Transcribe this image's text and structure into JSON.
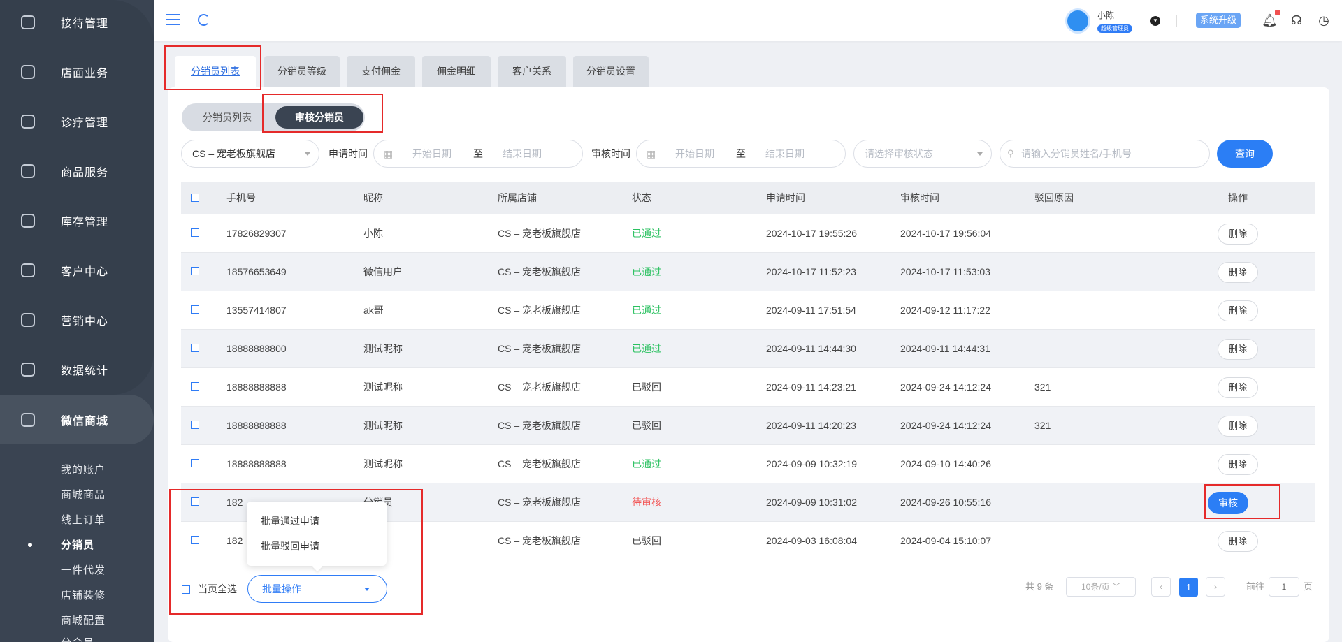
{
  "sidebar": {
    "items": [
      {
        "label": "接待管理",
        "icon": "reception-icon"
      },
      {
        "label": "店面业务",
        "icon": "store-icon"
      },
      {
        "label": "诊疗管理",
        "icon": "medical-icon"
      },
      {
        "label": "商品服务",
        "icon": "goods-icon"
      },
      {
        "label": "库存管理",
        "icon": "inventory-icon"
      },
      {
        "label": "客户中心",
        "icon": "customer-icon"
      },
      {
        "label": "营销中心",
        "icon": "marketing-icon"
      },
      {
        "label": "数据统计",
        "icon": "stats-icon"
      },
      {
        "label": "微信商城",
        "icon": "wechat-icon"
      }
    ],
    "sub_items": [
      "我的账户",
      "商城商品",
      "线上订单",
      "分销员",
      "一件代发",
      "店铺装修",
      "商城配置",
      "分会员"
    ]
  },
  "header": {
    "user_name": "小陈",
    "user_role": "超级管理员",
    "upgrade_label": "系统升级"
  },
  "tabs": [
    "分销员列表",
    "分销员等级",
    "支付佣金",
    "佣金明细",
    "客户关系",
    "分销员设置"
  ],
  "segment": {
    "left": "分销员列表",
    "right": "审核分销员"
  },
  "filters": {
    "store": "CS – 宠老板旗舰店",
    "apply_time_label": "申请时间",
    "audit_time_label": "审核时间",
    "start_placeholder": "开始日期",
    "end_placeholder": "结束日期",
    "to_label": "至",
    "status_placeholder": "请选择审核状态",
    "search_placeholder": "请输入分销员姓名/手机号",
    "query_label": "查询"
  },
  "table": {
    "headers": [
      "手机号",
      "昵称",
      "所属店铺",
      "状态",
      "申请时间",
      "审核时间",
      "驳回原因",
      "操作"
    ],
    "rows": [
      {
        "phone": "17826829307",
        "nickname": "小陈",
        "store": "CS – 宠老板旗舰店",
        "status": "已通过",
        "applied": "2024-10-17 19:55:26",
        "audited": "2024-10-17 19:56:04",
        "reason": "",
        "action": "删除"
      },
      {
        "phone": "18576653649",
        "nickname": "微信用户",
        "store": "CS – 宠老板旗舰店",
        "status": "已通过",
        "applied": "2024-10-17 11:52:23",
        "audited": "2024-10-17 11:53:03",
        "reason": "",
        "action": "删除"
      },
      {
        "phone": "13557414807",
        "nickname": "ak哥",
        "store": "CS – 宠老板旗舰店",
        "status": "已通过",
        "applied": "2024-09-11 17:51:54",
        "audited": "2024-09-12 11:17:22",
        "reason": "",
        "action": "删除"
      },
      {
        "phone": "18888888800",
        "nickname": "测试昵称",
        "store": "CS – 宠老板旗舰店",
        "status": "已通过",
        "applied": "2024-09-11 14:44:30",
        "audited": "2024-09-11 14:44:31",
        "reason": "",
        "action": "删除"
      },
      {
        "phone": "18888888888",
        "nickname": "测试昵称",
        "store": "CS – 宠老板旗舰店",
        "status": "已驳回",
        "applied": "2024-09-11 14:23:21",
        "audited": "2024-09-24 14:12:24",
        "reason": "321",
        "action": "删除"
      },
      {
        "phone": "18888888888",
        "nickname": "测试昵称",
        "store": "CS – 宠老板旗舰店",
        "status": "已驳回",
        "applied": "2024-09-11 14:20:23",
        "audited": "2024-09-24 14:12:24",
        "reason": "321",
        "action": "删除"
      },
      {
        "phone": "18888888888",
        "nickname": "测试昵称",
        "store": "CS – 宠老板旗舰店",
        "status": "已通过",
        "applied": "2024-09-09 10:32:19",
        "audited": "2024-09-10 14:40:26",
        "reason": "",
        "action": "删除"
      },
      {
        "phone": "182",
        "nickname": "分销员",
        "store": "CS – 宠老板旗舰店",
        "status": "待审核",
        "applied": "2024-09-09 10:31:02",
        "audited": "2024-09-26 10:55:16",
        "reason": "",
        "action": "审核"
      },
      {
        "phone": "182",
        "nickname": "",
        "store": "CS – 宠老板旗舰店",
        "status": "已驳回",
        "applied": "2024-09-03 16:08:04",
        "audited": "2024-09-04 15:10:07",
        "reason": "",
        "action": "删除"
      }
    ]
  },
  "bulk": {
    "select_all_label": "当页全选",
    "menu_items": [
      "批量通过申请",
      "批量驳回申请"
    ],
    "button_label": "批量操作"
  },
  "pagination": {
    "total": "共 9 条",
    "page_size": "10条/页",
    "current_page": "1",
    "goto_label": "前往",
    "goto_value": "1",
    "page_unit": "页"
  },
  "colors": {
    "accent": "#2b7ef5",
    "sidebar": "#3a4452",
    "passed": "#2ac160",
    "pending": "#f25858",
    "highlight": "#e52a2a"
  }
}
